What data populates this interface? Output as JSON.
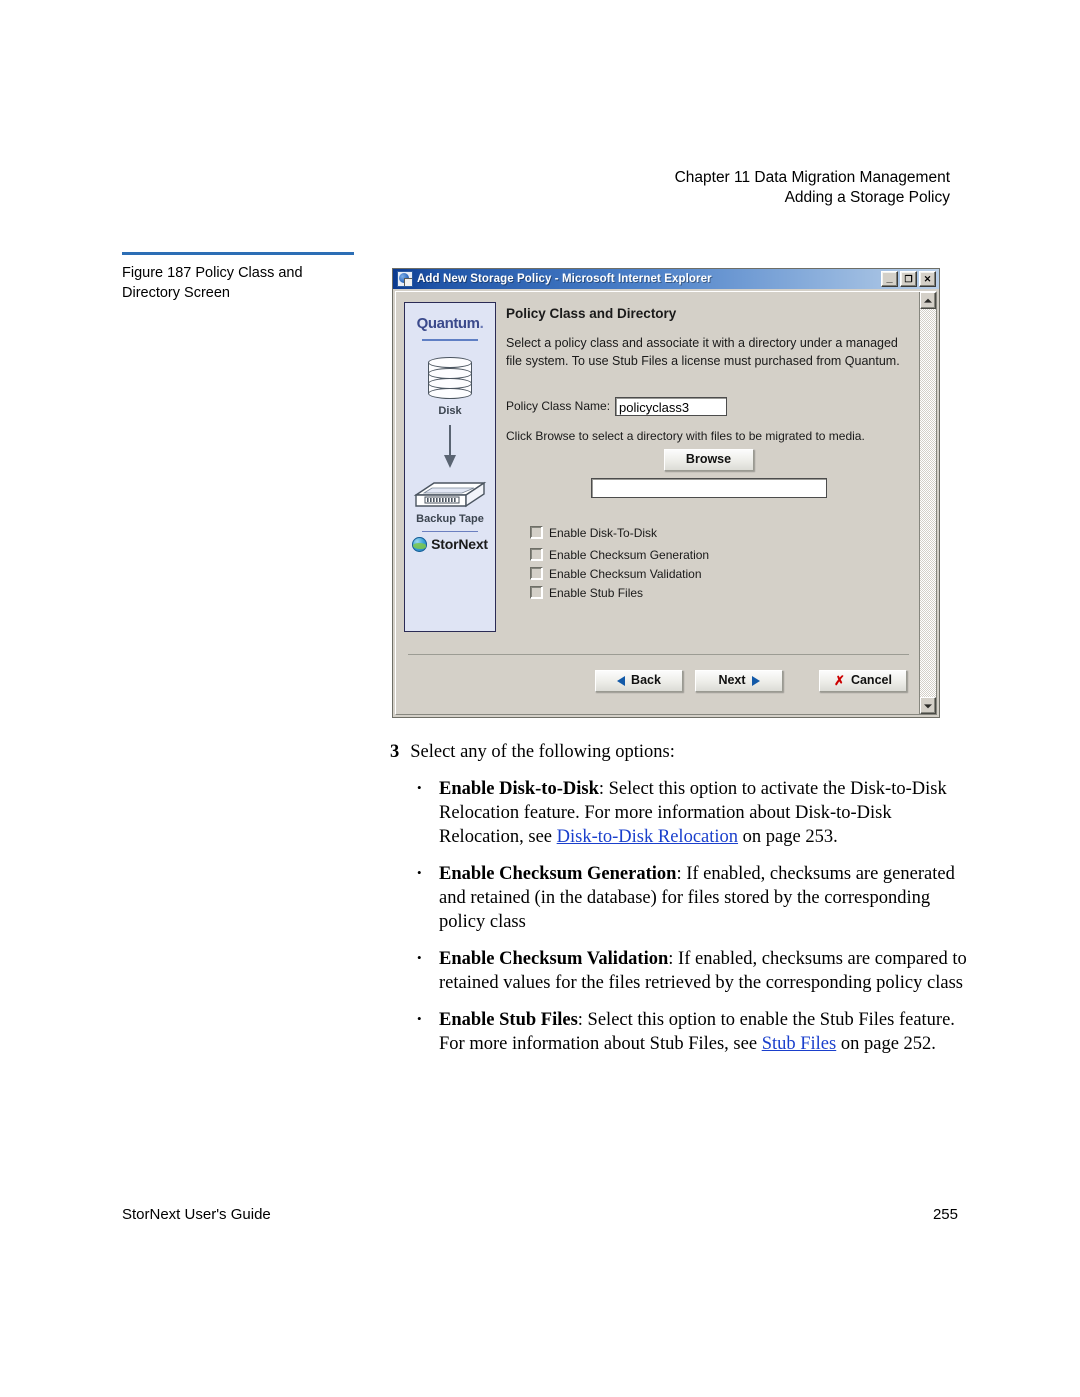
{
  "running_head": {
    "line1": "Chapter 11  Data Migration Management",
    "line2": "Adding a Storage Policy"
  },
  "figure": {
    "number": "Figure 187",
    "title": "Policy Class and",
    "title_line2": "Directory Screen"
  },
  "dialog": {
    "window_title": "Add New Storage Policy - Microsoft Internet Explorer",
    "window_buttons": {
      "minimize": "_",
      "maximize": "❐",
      "close": "✕"
    },
    "sidebar": {
      "brand": "Quantum",
      "brand_dot": ".",
      "disk_label": "Disk",
      "tape_label": "Backup Tape",
      "product": "StorNext"
    },
    "pane": {
      "title": "Policy Class and Directory",
      "description": "Select a policy class and associate it with a directory under a managed file system. To use Stub Files a license must purchased from Quantum.",
      "policy_class_label": "Policy Class Name:",
      "policy_class_value": "policyclass3",
      "browse_hint": "Click Browse to select a directory with files to be migrated to media.",
      "browse_button": "Browse",
      "directory_value": "",
      "directory_placeholder": ""
    },
    "checkboxes": [
      {
        "label": "Enable Disk-To-Disk",
        "checked": false
      },
      {
        "label": "Enable Checksum Generation",
        "checked": false
      },
      {
        "label": "Enable Checksum Validation",
        "checked": false
      },
      {
        "label": "Enable Stub Files",
        "checked": false
      }
    ],
    "buttons": {
      "back": "Back",
      "next": "Next",
      "cancel": "Cancel",
      "cancel_mark": "✗"
    }
  },
  "body": {
    "step_number": "3",
    "step_text": "Select any of the following options:",
    "bullet_marker": "•",
    "bullets": [
      {
        "term": "Enable Disk-to-Disk",
        "text_before": ": Select this option to activate the Disk-to-Disk Relocation feature. For more information about Disk-to-Disk Relocation, see ",
        "link": "Disk-to-Disk Relocation",
        "text_after": " on page  253."
      },
      {
        "term": "Enable Checksum Generation",
        "text_before": ": If enabled, checksums are generated and retained (in the database) for files stored by the corresponding policy class",
        "link": "",
        "text_after": ""
      },
      {
        "term": "Enable Checksum Validation",
        "text_before": ": If enabled, checksums are compared to retained values for the files retrieved by the corresponding policy class",
        "link": "",
        "text_after": ""
      },
      {
        "term": "Enable Stub Files",
        "text_before": ": Select this option to enable the Stub Files feature. For more information about Stub Files, see ",
        "link": "Stub Files",
        "text_after": " on page  252."
      }
    ]
  },
  "footer": {
    "guide": "StorNext User's Guide",
    "page_number": "255"
  },
  "colors": {
    "accent_rule": "#2c6eb5",
    "link": "#1a3fcc",
    "titlebar": "#2055a8",
    "dialog_face": "#d4d0c8",
    "sidebar_bg": "#dfe4f4",
    "cancel_x": "#cc0000"
  }
}
